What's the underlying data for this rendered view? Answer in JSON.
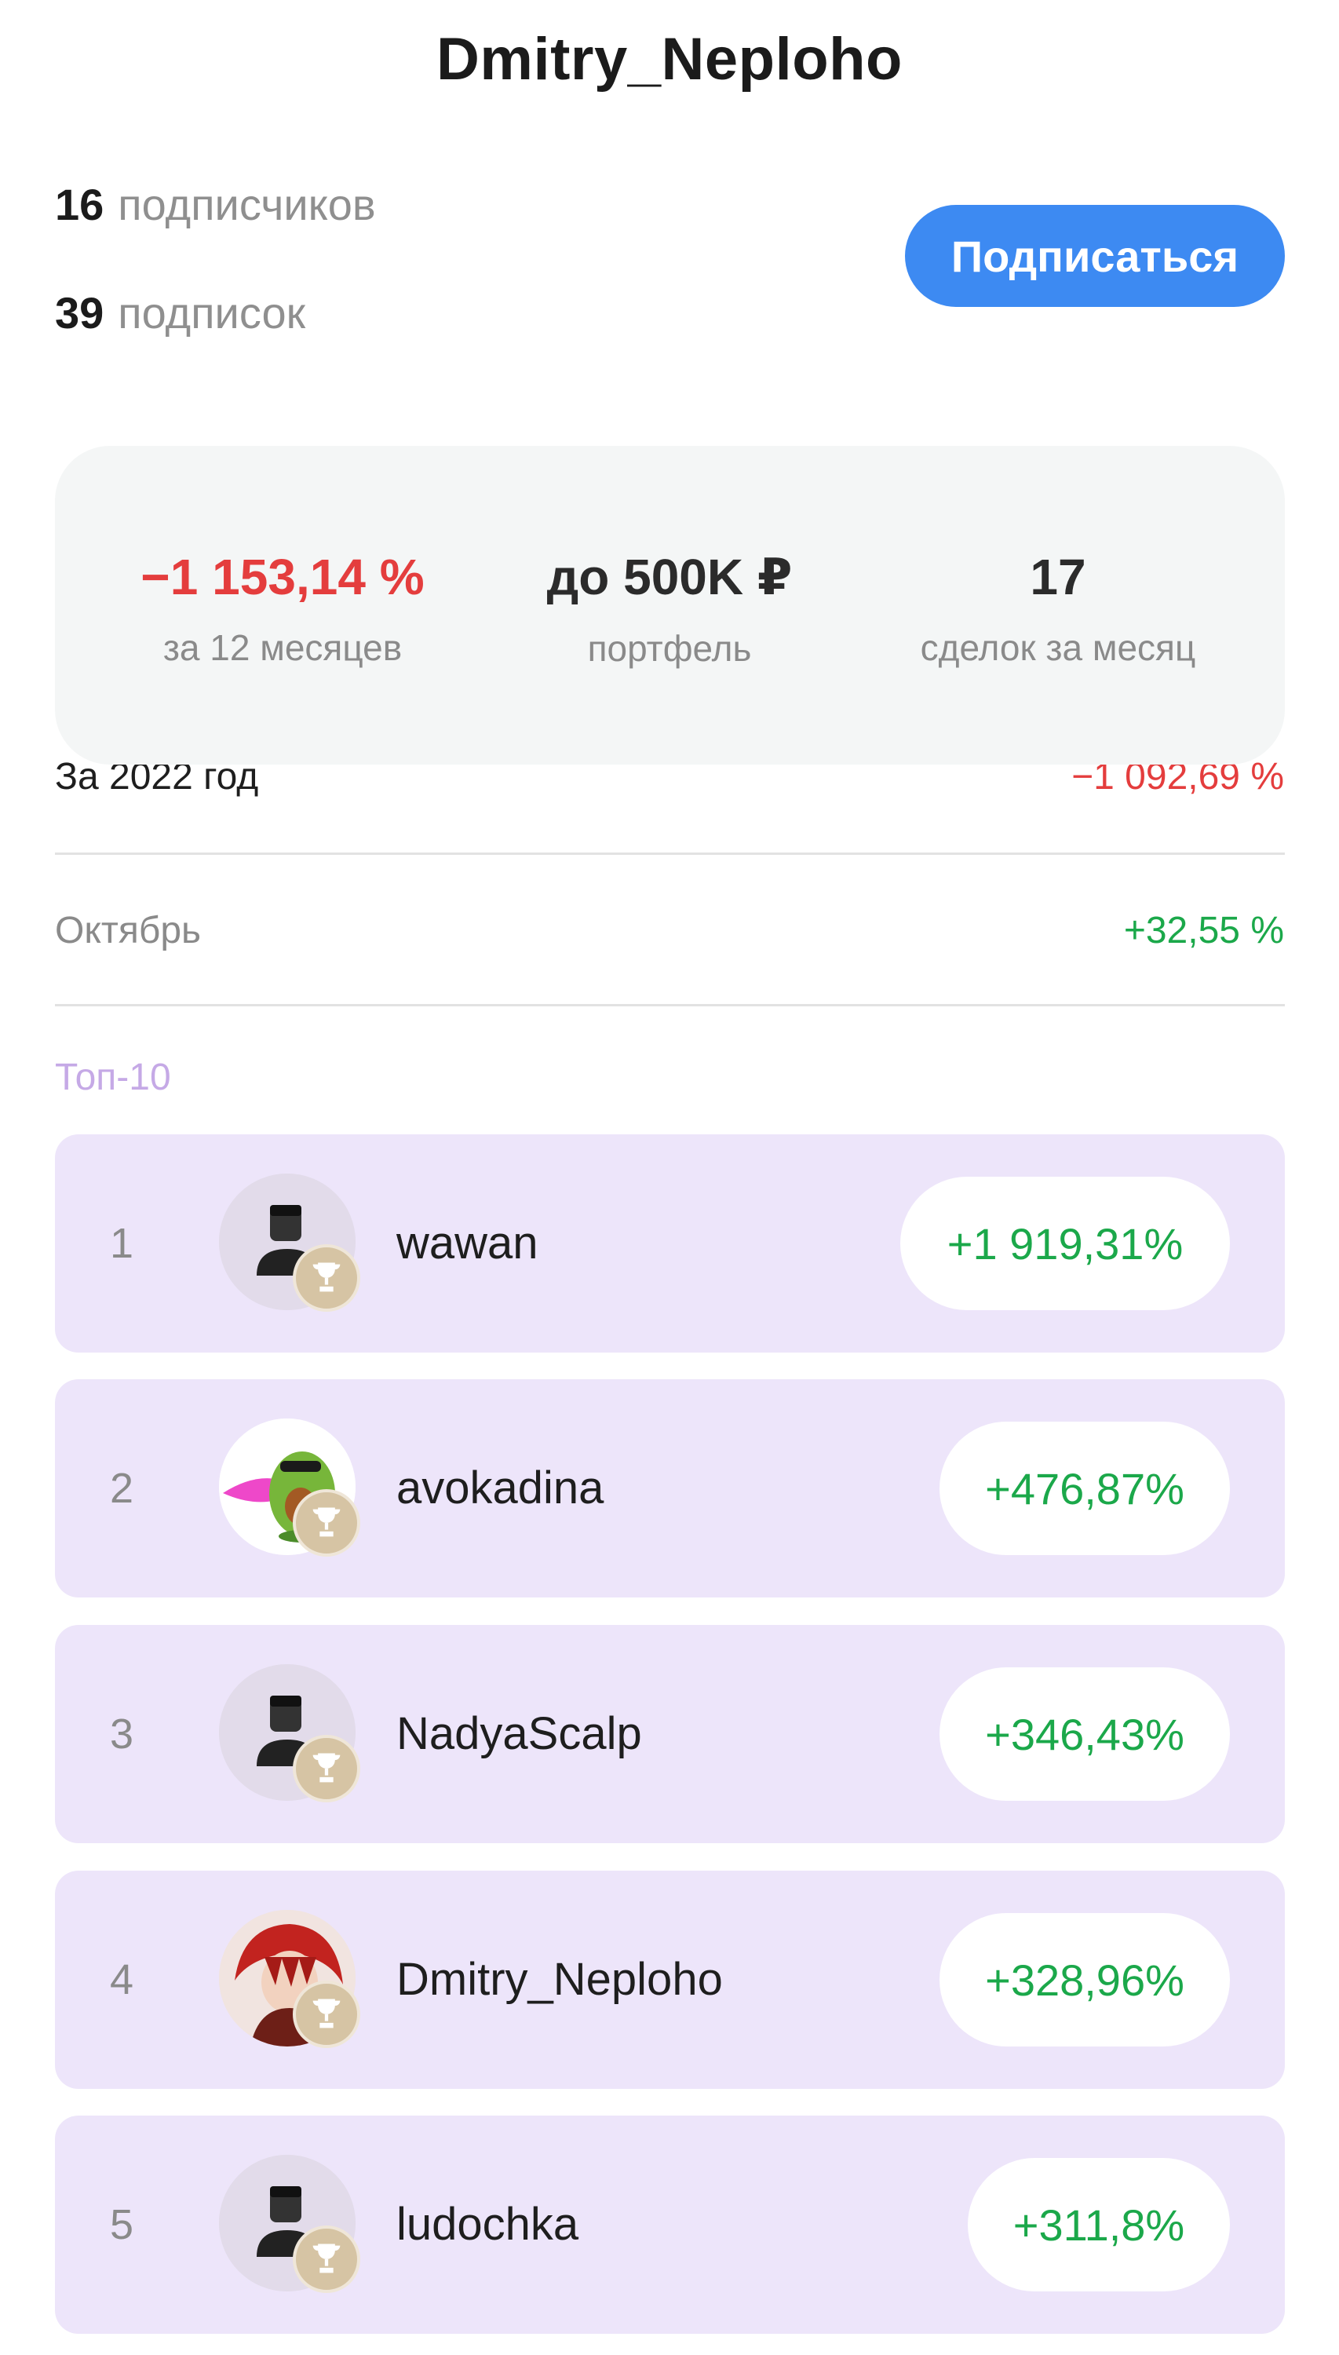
{
  "profile": {
    "username": "Dmitry_Neploho",
    "followers_count": "16",
    "followers_label": "подписчиков",
    "following_count": "39",
    "following_label": "подписок",
    "follow_button": "Подписаться"
  },
  "summary": {
    "return_value": "−1 153,14 %",
    "return_label": "за 12 месяцев",
    "portfolio_value": "до 500K ₽",
    "portfolio_label": "портфель",
    "deals_value": "17",
    "deals_label": "сделок за месяц"
  },
  "periods": [
    {
      "label": "За 2022 год",
      "value": "−1 092,69 %",
      "color": "#e43d3d"
    },
    {
      "label": "Октябрь",
      "value": "+32,55 %",
      "color": "#1ba84a"
    }
  ],
  "top": {
    "label": "Топ-10",
    "entries": [
      {
        "rank": "1",
        "name": "wawan",
        "change": "+1 919,31%",
        "avatar": "default-user-icon"
      },
      {
        "rank": "2",
        "name": "avokadina",
        "change": "+476,87%",
        "avatar": "avocado-image"
      },
      {
        "rank": "3",
        "name": "NadyaScalp",
        "change": "+346,43%",
        "avatar": "default-user-icon"
      },
      {
        "rank": "4",
        "name": "Dmitry_Neploho",
        "change": "+328,96%",
        "avatar": "anime-character-image"
      },
      {
        "rank": "5",
        "name": "ludochka",
        "change": "+311,8%",
        "avatar": "default-user-icon"
      }
    ]
  },
  "colors": {
    "accent": "#3d8af2",
    "negative": "#e43d3d",
    "positive": "#1ba84a",
    "card_bg": "#ede5fa",
    "top_label": "#c5a9e6"
  }
}
